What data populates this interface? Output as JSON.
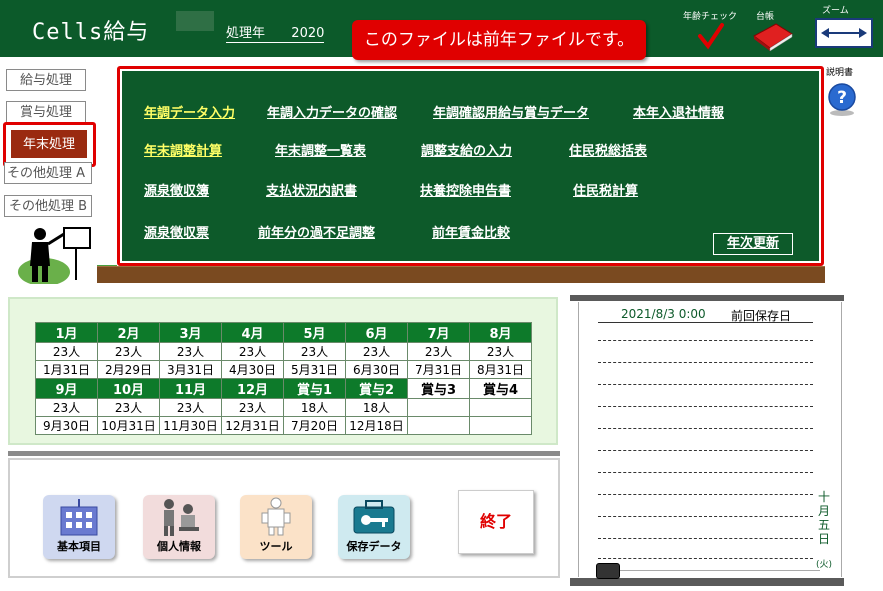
{
  "header": {
    "app_title": "Cells給与",
    "year_label": "処理年",
    "year_value": "2020",
    "notice": "このファイルは前年ファイルです。",
    "age_check_label": "年齢チェック",
    "ledger_label": "台帳",
    "zoom_label": "ズーム",
    "manual_label": "説明書"
  },
  "sidebar": {
    "items": [
      {
        "label": "給与処理"
      },
      {
        "label": "賞与処理"
      },
      {
        "label": "年末処理"
      },
      {
        "label": "その他処理 A"
      },
      {
        "label": "その他処理 B"
      }
    ]
  },
  "board": {
    "row1": [
      "年調データ入力",
      "年調入力データの確認",
      "年調確認用給与賞与データ",
      "本年入退社情報"
    ],
    "row2": [
      "年末調整計算",
      "年末調整一覧表",
      "調整支給の入力",
      "住民税総括表"
    ],
    "row3": [
      "源泉徴収簿",
      "支払状況内訳書",
      "扶養控除申告書",
      "住民税計算"
    ],
    "row4": [
      "源泉徴収票",
      "前年分の過不足調整",
      "前年賃金比較"
    ],
    "annual_update": "年次更新"
  },
  "calendar": {
    "months_a": [
      "1月",
      "2月",
      "3月",
      "4月",
      "5月",
      "6月",
      "7月",
      "8月"
    ],
    "counts_a": [
      "23人",
      "23人",
      "23人",
      "23人",
      "23人",
      "23人",
      "23人",
      "23人"
    ],
    "dates_a": [
      "1月31日",
      "2月29日",
      "3月31日",
      "4月30日",
      "5月31日",
      "6月30日",
      "7月31日",
      "8月31日"
    ],
    "months_b": [
      "9月",
      "10月",
      "11月",
      "12月",
      "賞与1",
      "賞与2",
      "賞与3",
      "賞与4"
    ],
    "counts_b": [
      "23人",
      "23人",
      "23人",
      "23人",
      "18人",
      "18人",
      "",
      ""
    ],
    "dates_b": [
      "9月30日",
      "10月31日",
      "11月30日",
      "12月31日",
      "7月20日",
      "12月18日",
      "",
      ""
    ]
  },
  "bottom": {
    "kihon": "基本項目",
    "kojin": "個人情報",
    "tool": "ツール",
    "hozon": "保存データ",
    "end": "終了"
  },
  "memo": {
    "date": "2021/8/3 0:00",
    "save_label": "前回保存日",
    "vertical_date": [
      "十",
      "月",
      "五",
      "日"
    ],
    "weekday": "(火)"
  },
  "colors": {
    "header_bg": "#0c5a2a",
    "board_bg": "#0d5a2a",
    "notice_bg": "#e00000",
    "highlight_link": "#ffff66"
  }
}
